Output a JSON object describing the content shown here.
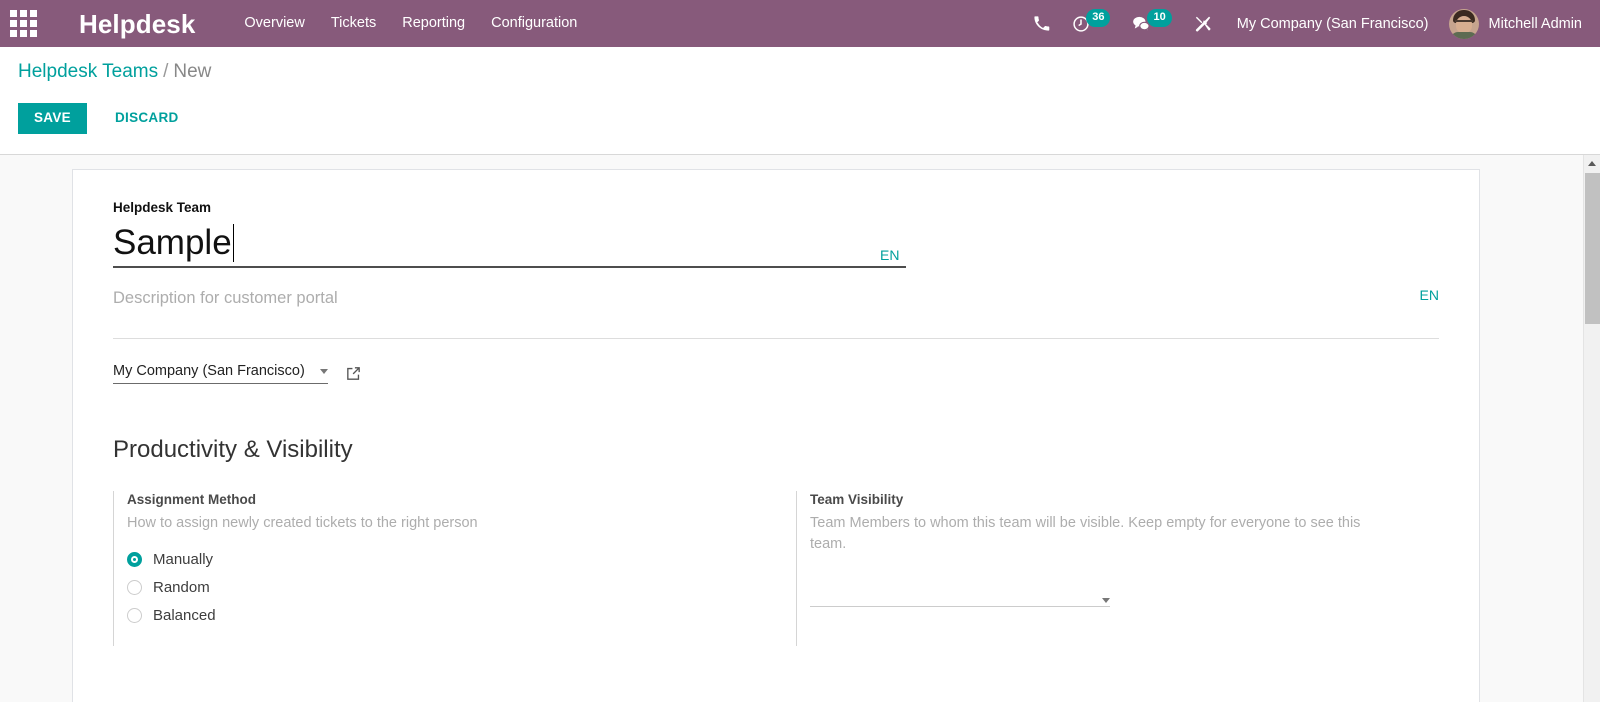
{
  "navbar": {
    "apps_icon": "apps-grid-icon",
    "brand": "Helpdesk",
    "menu": [
      {
        "label": "Overview"
      },
      {
        "label": "Tickets"
      },
      {
        "label": "Reporting"
      },
      {
        "label": "Configuration"
      }
    ],
    "icons": [
      {
        "name": "phone-icon",
        "badge": null
      },
      {
        "name": "activity-clock-icon",
        "badge": "36"
      },
      {
        "name": "messages-chat-icon",
        "badge": "10"
      },
      {
        "name": "developer-tools-icon",
        "badge": null
      }
    ],
    "company": "My Company (San Francisco)",
    "user_name": "Mitchell Admin",
    "avatar": "user-avatar"
  },
  "control_panel": {
    "breadcrumb": {
      "parent": "Helpdesk Teams",
      "separator": "/",
      "current": "New"
    },
    "save_label": "SAVE",
    "discard_label": "DISCARD"
  },
  "form": {
    "team_label": "Helpdesk Team",
    "team_name_value": "Sample",
    "team_name_lang": "EN",
    "description_placeholder": "Description for customer portal",
    "description_lang": "EN",
    "company_value": "My Company (San Francisco)",
    "external_link_icon": "external-link-icon",
    "section_title": "Productivity & Visibility",
    "assignment": {
      "title": "Assignment Method",
      "help": "How to assign newly created tickets to the right person",
      "options": [
        {
          "label": "Manually",
          "checked": true
        },
        {
          "label": "Random",
          "checked": false
        },
        {
          "label": "Balanced",
          "checked": false
        }
      ]
    },
    "visibility": {
      "title": "Team Visibility",
      "help": "Team Members to whom this team will be visible. Keep empty for everyone to see this team.",
      "value": ""
    }
  },
  "colors": {
    "brand_purple": "#875A7B",
    "accent_teal": "#00A09D",
    "page_bg": "#f9f9f9"
  }
}
